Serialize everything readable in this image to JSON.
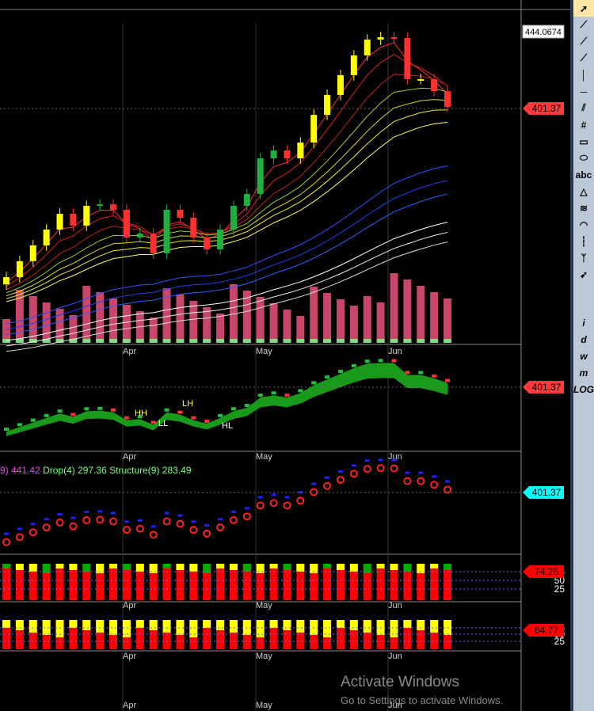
{
  "price_labels": {
    "top": "444.0674",
    "main": "401.37",
    "panel2": "401.37",
    "panel3": "401.37",
    "panel4": "74.26",
    "panel5": "64.77"
  },
  "axis_levels": [
    "75",
    "50",
    "25"
  ],
  "months": [
    "Apr",
    "May",
    "Jun"
  ],
  "legend": {
    "pre": "9) 441.42",
    "drop": "Drop(4) 297.36",
    "structure": "Structure(9) 283.49"
  },
  "annotations": [
    "HH",
    "LH",
    "LL",
    "HL"
  ],
  "toolbar": [
    "pointer-icon",
    "line-icon",
    "ray-icon",
    "extended-line-icon",
    "vertical-line-icon",
    "horizontal-line-icon",
    "parallel-lines-icon",
    "channel-icon",
    "rectangle-icon",
    "ellipse-icon",
    "abc",
    "triangle-icon",
    "fib-icon",
    "arc-icon",
    "cycle-lines-icon",
    "zigzag-icon",
    "arrow-icon"
  ],
  "toolbar2": [
    "i",
    "d",
    "w",
    "m",
    "LOG"
  ],
  "watermark": {
    "title": "Activate Windows",
    "sub": "Go to Settings to activate Windows."
  },
  "chart_data": {
    "type": "candlestick",
    "closes": [
      307.5,
      316.4,
      325.2,
      334,
      342.8,
      336.2,
      347.2,
      348,
      345,
      329.6,
      331.8,
      320.8,
      345,
      340.6,
      329.6,
      323,
      334,
      347.2,
      353.8,
      373.6,
      378,
      373.6,
      382.4,
      397.8,
      408.9,
      419.9,
      430.9,
      439.7,
      441,
      440.6,
      417.7,
      417.7,
      411,
      402.2
    ],
    "last": 401.37,
    "ylim": [
      270,
      450
    ],
    "x_ticks": [
      "Apr",
      "May",
      "Jun"
    ]
  }
}
